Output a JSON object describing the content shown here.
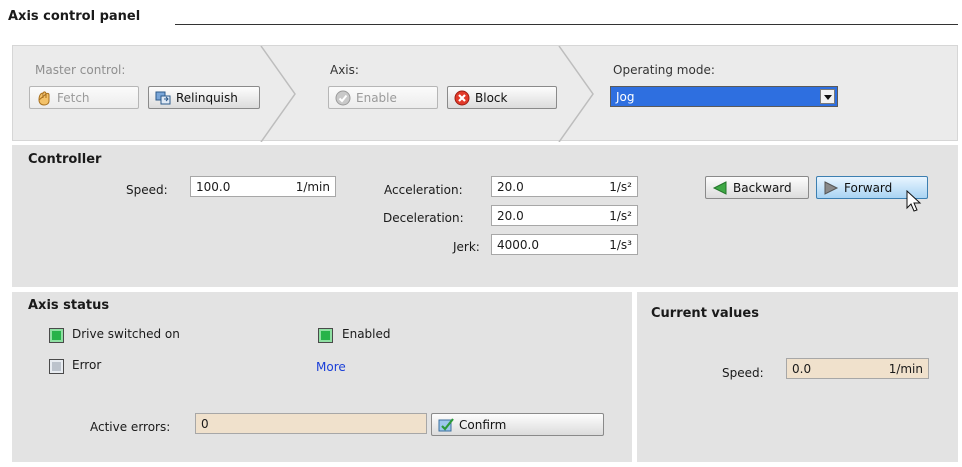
{
  "title": "Axis control panel",
  "master_control": {
    "label": "Master control:",
    "fetch_label": "Fetch",
    "relinquish_label": "Relinquish"
  },
  "axis": {
    "label": "Axis:",
    "enable_label": "Enable",
    "block_label": "Block"
  },
  "operating_mode": {
    "label": "Operating mode:",
    "value": "Jog"
  },
  "controller": {
    "title": "Controller",
    "speed": {
      "label": "Speed:",
      "value": "100.0",
      "unit": "1/min"
    },
    "acceleration": {
      "label": "Acceleration:",
      "value": "20.0",
      "unit": "1/s²"
    },
    "deceleration": {
      "label": "Deceleration:",
      "value": "20.0",
      "unit": "1/s²"
    },
    "jerk": {
      "label": "Jerk:",
      "value": "4000.0",
      "unit": "1/s³"
    },
    "backward_label": "Backward",
    "forward_label": "Forward"
  },
  "axis_status": {
    "title": "Axis status",
    "drive_switched_on": "Drive switched on",
    "enabled": "Enabled",
    "error": "Error",
    "more_link": "More",
    "active_errors_label": "Active errors:",
    "active_errors_value": "0",
    "confirm_label": "Confirm"
  },
  "current_values": {
    "title": "Current values",
    "speed_label": "Speed:",
    "speed_value": "0.0",
    "speed_unit": "1/min"
  },
  "colors": {
    "selection_blue": "#2e6fe0",
    "status_green": "#27b34a",
    "readonly_field": "#f0e1cc",
    "link_blue": "#1a3fd8"
  }
}
